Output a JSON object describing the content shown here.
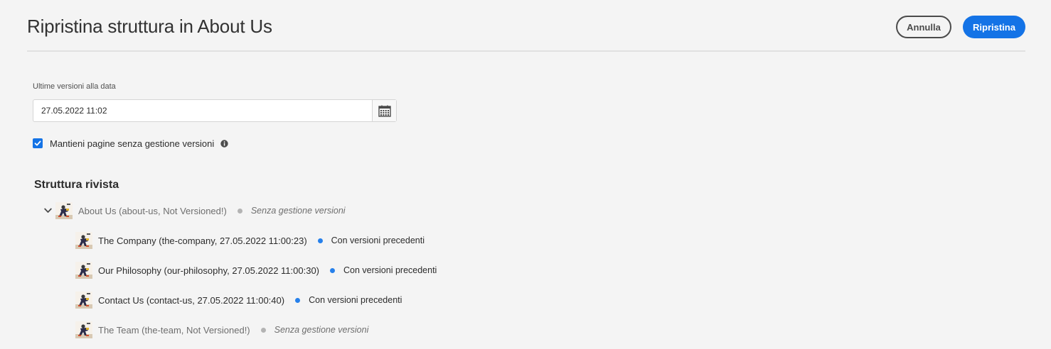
{
  "header": {
    "title": "Ripristina struttura in About Us",
    "cancel_label": "Annulla",
    "restore_label": "Ripristina"
  },
  "form": {
    "date_label": "Ultime versioni alla data",
    "date_value": "27.05.2022 11:02",
    "calendar_icon": "calendar-icon",
    "keep_unversioned_label": "Mantieni pagine senza gestione versioni",
    "keep_unversioned_checked": true,
    "info_icon": "info-icon"
  },
  "tree": {
    "section_title": "Struttura rivista",
    "root": {
      "label": "About Us (about-us, Not Versioned!)",
      "status": "Senza gestione versioni",
      "status_kind": "unversioned",
      "expanded": true
    },
    "children": [
      {
        "label": "The Company (the-company, 27.05.2022 11:00:23)",
        "status": "Con versioni precedenti",
        "status_kind": "versioned"
      },
      {
        "label": "Our Philosophy (our-philosophy, 27.05.2022 11:00:30)",
        "status": "Con versioni precedenti",
        "status_kind": "versioned"
      },
      {
        "label": "Contact Us (contact-us, 27.05.2022 11:00:40)",
        "status": "Con versioni precedenti",
        "status_kind": "versioned"
      },
      {
        "label": "The Team (the-team, Not Versioned!)",
        "status": "Senza gestione versioni",
        "status_kind": "unversioned"
      }
    ]
  },
  "colors": {
    "accent": "#1473e6",
    "dot_versioned": "#2680eb",
    "dot_unversioned": "#b3b3b3"
  }
}
